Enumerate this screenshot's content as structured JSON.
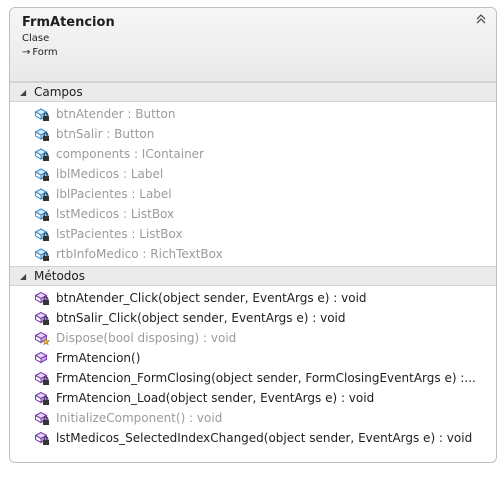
{
  "header": {
    "title": "FrmAtencion",
    "kind": "Clase",
    "inherits": "Form",
    "inherits_arrow": "→"
  },
  "fields": {
    "label": "Campos",
    "items": [
      {
        "text": "btnAtender : Button",
        "icon": "private-field-icon",
        "muted": true
      },
      {
        "text": "btnSalir : Button",
        "icon": "private-field-icon",
        "muted": true
      },
      {
        "text": "components : IContainer",
        "icon": "private-field-icon",
        "muted": true
      },
      {
        "text": "lblMedicos : Label",
        "icon": "private-field-icon",
        "muted": true
      },
      {
        "text": "lblPacientes : Label",
        "icon": "private-field-icon",
        "muted": true
      },
      {
        "text": "lstMedicos : ListBox",
        "icon": "private-field-icon",
        "muted": true
      },
      {
        "text": "lstPacientes : ListBox",
        "icon": "private-field-icon",
        "muted": true
      },
      {
        "text": "rtbInfoMedico : RichTextBox",
        "icon": "private-field-icon",
        "muted": true
      }
    ]
  },
  "methods": {
    "label": "Métodos",
    "items": [
      {
        "text": "btnAtender_Click(object sender, EventArgs e) : void",
        "icon": "private-method-icon",
        "muted": false
      },
      {
        "text": "btnSalir_Click(object sender, EventArgs e) : void",
        "icon": "private-method-icon",
        "muted": false
      },
      {
        "text": "Dispose(bool disposing) : void",
        "icon": "protected-override-method-icon",
        "muted": true
      },
      {
        "text": "FrmAtencion()",
        "icon": "public-constructor-icon",
        "muted": false
      },
      {
        "text": "FrmAtencion_FormClosing(object sender, FormClosingEventArgs e) :...",
        "icon": "private-method-icon",
        "muted": false
      },
      {
        "text": "FrmAtencion_Load(object sender, EventArgs e) : void",
        "icon": "private-method-icon",
        "muted": false
      },
      {
        "text": "InitializeComponent() : void",
        "icon": "private-method-icon",
        "muted": true
      },
      {
        "text": "lstMedicos_SelectedIndexChanged(object sender, EventArgs e) : void",
        "icon": "private-method-icon",
        "muted": false
      }
    ]
  },
  "colors": {
    "field_icon": "#3a8fd0",
    "method_icon": "#7a3fb0",
    "muted_text": "#9b9b9b",
    "text": "#1e1e1e"
  }
}
